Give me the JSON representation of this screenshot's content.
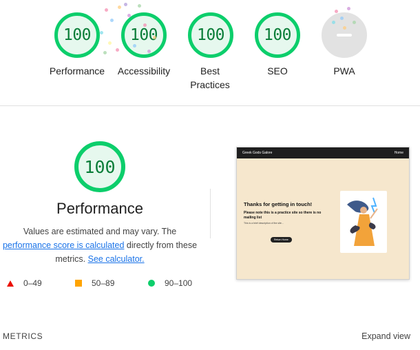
{
  "categories": [
    {
      "score": "100",
      "label": "Performance"
    },
    {
      "score": "100",
      "label": "Accessibility"
    },
    {
      "score": "100",
      "label": "Best Practices"
    },
    {
      "score": "100",
      "label": "SEO"
    },
    {
      "score": "",
      "label": "PWA"
    }
  ],
  "performance": {
    "score": "100",
    "title": "Performance",
    "desc_prefix": "Values are estimated and may vary. The ",
    "link_score": "performance score is calculated",
    "desc_mid": " directly from these metrics. ",
    "link_calculator": "See calculator."
  },
  "legend": [
    {
      "range": "0–49",
      "icon": "triangle",
      "color": "#eb0f00"
    },
    {
      "range": "50–89",
      "icon": "square",
      "color": "#ffa400"
    },
    {
      "range": "90–100",
      "icon": "circle",
      "color": "#0cce6b"
    }
  ],
  "screenshot": {
    "site_name": "Greek Gods Galore",
    "nav_home": "Home",
    "heading": "Thanks for getting in touch!",
    "subheading": "Please note this is a practice site so there is no mailing list",
    "body_text": "This is a brief description of the site...",
    "button": "Return Home"
  },
  "metrics_label": "METRICS",
  "expand_view": "Expand view",
  "colors": {
    "pass": "#0cce6b",
    "average": "#ffa400",
    "fail": "#eb0f00",
    "link": "#1a73e8"
  }
}
